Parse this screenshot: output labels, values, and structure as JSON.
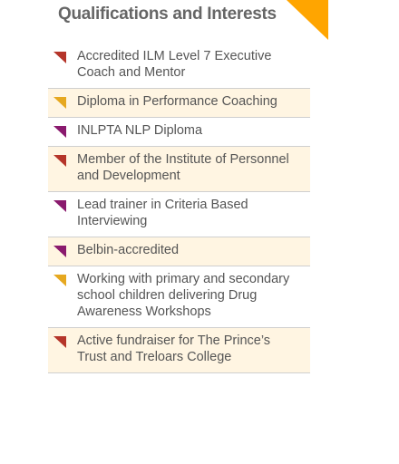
{
  "section": {
    "title": "Qualifications and Interests",
    "corner_icon": "orange-corner-triangle",
    "corner_color": "#ffa500"
  },
  "colors": {
    "red": "#b5352a",
    "gold": "#e6a820",
    "purple": "#8a1a6e",
    "shaded_row": "#fff5e2",
    "divider": "#cfcfcf"
  },
  "items": [
    {
      "label": "Accredited ILM Level 7 Executive Coach and Mentor",
      "bullet": "red",
      "shaded": false
    },
    {
      "label": "Diploma in Performance Coaching",
      "bullet": "gold",
      "shaded": true
    },
    {
      "label": "INLPTA NLP Diploma",
      "bullet": "purple",
      "shaded": false
    },
    {
      "label": "Member of the Institute of Personnel and Development",
      "bullet": "red",
      "shaded": true
    },
    {
      "label": "Lead trainer in Criteria Based Interviewing",
      "bullet": "purple",
      "shaded": false
    },
    {
      "label": "Belbin-accredited",
      "bullet": "purple",
      "shaded": true
    },
    {
      "label": "Working with primary and secondary school children delivering Drug Awareness Workshops",
      "bullet": "gold",
      "shaded": false
    },
    {
      "label": "Active fundraiser for The Prince’s Trust and Treloars College",
      "bullet": "red",
      "shaded": true
    }
  ]
}
